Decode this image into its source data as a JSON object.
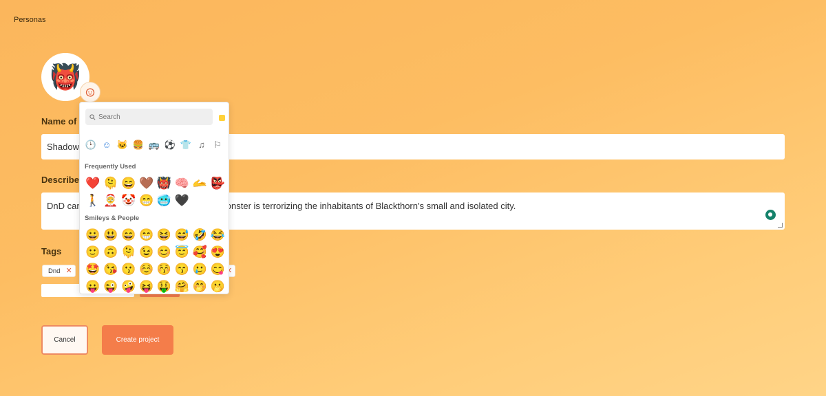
{
  "breadcrumb": "Personas",
  "avatar_emoji": "👹",
  "avatar_edit_icon": "😊",
  "name_field": {
    "label": "Name of",
    "value": "Shadow"
  },
  "description_field": {
    "label": "Describe",
    "value": "DnD car                                           vhere a monster is terrorizing the inhabitants of Blackthorn's small and isolated city."
  },
  "tags": {
    "label": "Tags",
    "items": [
      "Dnd"
    ],
    "remove_icon": "✕"
  },
  "buttons": {
    "cancel": "Cancel",
    "create": "Create project"
  },
  "emoji_picker": {
    "search_placeholder": "Search",
    "search_icon": "🔍",
    "skin_tone_color": "#ffd23a",
    "categories": [
      "🕑",
      "☺",
      "🐱",
      "🍔",
      "🚌",
      "⚽",
      "👕",
      "♫",
      "⚐"
    ],
    "frequently_used_title": "Frequently Used",
    "frequently_used": [
      "❤️",
      "🫠",
      "😄",
      "🤎",
      "👹",
      "🧠",
      "🫴",
      "👺",
      "🚶",
      "🤶",
      "🤡",
      "😁",
      "🥶",
      "🖤"
    ],
    "smileys_title": "Smileys & People",
    "smileys": [
      "😀",
      "😃",
      "😄",
      "😁",
      "😆",
      "😅",
      "🤣",
      "😂",
      "🙂",
      "🙃",
      "🫠",
      "😉",
      "😊",
      "😇",
      "🥰",
      "😍",
      "🤩",
      "😘",
      "😗",
      "☺️",
      "😚",
      "😙",
      "🥲",
      "😋",
      "😛",
      "😜",
      "🤪",
      "😝",
      "🤑",
      "🤗",
      "🤭",
      "🫢"
    ]
  },
  "colors": {
    "accent": "#f47d4a",
    "background_top": "#fbb65c",
    "background_bottom": "#ffd487"
  }
}
